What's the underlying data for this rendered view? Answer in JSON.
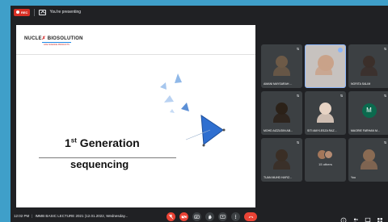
{
  "topbar": {
    "rec_label": "REC",
    "presenting_text": "You're presenting"
  },
  "slide": {
    "logo_left": "NUCLE",
    "logo_right": "BIOSOLUTION",
    "logo_sub": "LIFE SCIENCE PRODUCTS",
    "title_line1_prefix": "1",
    "title_line1_sup": "st",
    "title_line1_rest": " Generation",
    "title_line2": "sequencing"
  },
  "participants": [
    {
      "name": "AMANI MAYSARAH ...",
      "color": "#6d5a47"
    },
    {
      "name": "",
      "color": "#c9a289"
    },
    {
      "name": "NORITA SALIM",
      "color": "#3b2f2a"
    },
    {
      "name": "MOHD AIZZUDIN AB...",
      "color": "#2b2118"
    },
    {
      "name": "SITI AMYLESZA RAZ...",
      "color": "#e7d3c4"
    },
    {
      "name": "MAGRIE FARHAN M...",
      "letter": "M"
    },
    {
      "name": "TUAN MUHD HAFIZ...",
      "color": "#3a2e25"
    },
    {
      "name": "15 others"
    },
    {
      "name": "You",
      "color": "#8a6b53"
    }
  ],
  "bottombar": {
    "time": "12:02 PM",
    "separator": "|",
    "meeting_name": "IMMB BASIC LECTURE 2021 (12.01.2022, Wednesday..."
  },
  "colors": {
    "background": "#3f9fc9",
    "meet_dark": "#202124",
    "tile": "#3c4043",
    "end_call": "#ea4335",
    "accent_blue": "#8ab4f8"
  }
}
